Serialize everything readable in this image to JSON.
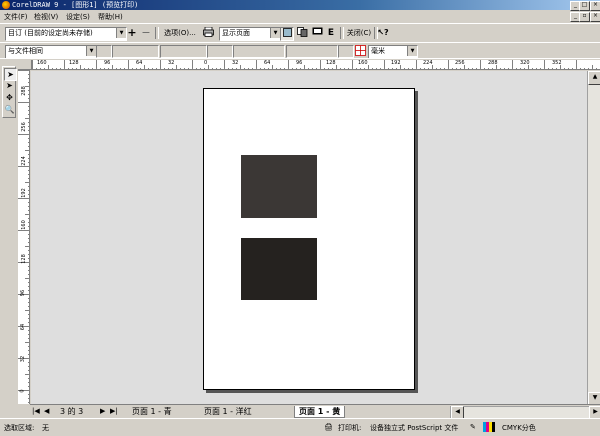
{
  "window": {
    "title": "CorelDRAW 9 - [图形1] (预览打印)",
    "minimize": "_",
    "maximize": "□",
    "close": "×"
  },
  "menu": {
    "items": [
      "文件(F)",
      "检视(V)",
      "设定(S)",
      "帮助(H)"
    ],
    "mdi_minimize": "_",
    "mdi_restore": "▫",
    "mdi_close": "×"
  },
  "toolbar1": {
    "preset_value": "目订 (目前的设定尚未存储)",
    "add_label": "+",
    "remove_label": "−",
    "options_label": "选项(O)...",
    "view_value": "显示页面",
    "close_label": "关闭(C)",
    "help_icon": "context-help-icon"
  },
  "toolbar2": {
    "position_value": "与文件相同",
    "units_value": "毫米"
  },
  "rulers": {
    "horizontal_labels": [
      "160",
      "128",
      "96",
      "64",
      "32",
      "0",
      "32",
      "64",
      "96",
      "128",
      "160",
      "192",
      "224",
      "256",
      "288",
      "320",
      "352"
    ],
    "vertical_labels": [
      "288",
      "256",
      "224",
      "192",
      "160",
      "128",
      "96",
      "64",
      "32",
      "0"
    ]
  },
  "canvas": {
    "background": "#dedede",
    "page_color": "#ffffff",
    "shapes": [
      {
        "name": "top-square",
        "color": "#3b3735"
      },
      {
        "name": "bottom-square",
        "color": "#25221f"
      }
    ]
  },
  "bottom": {
    "page_counter": "3 的 3",
    "tabs": [
      "页面  1 - 青",
      "页面  1 - 洋红",
      "页面  1 - 黄"
    ],
    "active_tab_index": 2
  },
  "status": {
    "selection_label": "选取区域:",
    "selection_value": "无",
    "printer_label": "打印机:",
    "printer_value": "设备独立式 PostScript 文件",
    "color_mode": "CMYK分色"
  }
}
